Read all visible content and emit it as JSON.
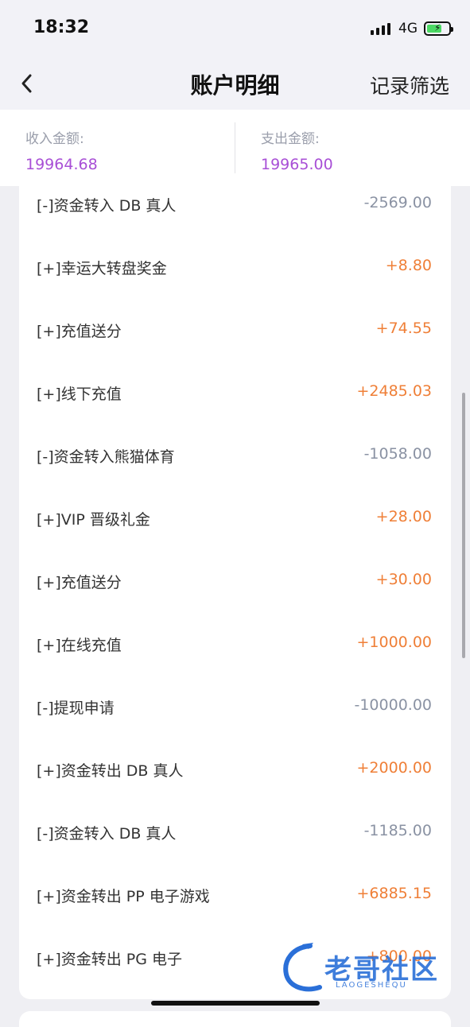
{
  "status_bar": {
    "time": "18:32",
    "network": "4G"
  },
  "nav": {
    "title": "账户明细",
    "filter_label": "记录筛选"
  },
  "summary": {
    "income_label": "收入金额:",
    "income_value": "19964.68",
    "expense_label": "支出金额:",
    "expense_value": "19965.00"
  },
  "records": [
    {
      "label": "[-]资金转入 DB 真人",
      "amount": "-2569.00",
      "type": "neg"
    },
    {
      "label": "[+]幸运大转盘奖金",
      "amount": "+8.80",
      "type": "pos"
    },
    {
      "label": "[+]充值送分",
      "amount": "+74.55",
      "type": "pos"
    },
    {
      "label": "[+]线下充值",
      "amount": "+2485.03",
      "type": "pos"
    },
    {
      "label": "[-]资金转入熊猫体育",
      "amount": "-1058.00",
      "type": "neg"
    },
    {
      "label": "[+]VIP 晋级礼金",
      "amount": "+28.00",
      "type": "pos"
    },
    {
      "label": "[+]充值送分",
      "amount": "+30.00",
      "type": "pos"
    },
    {
      "label": "[+]在线充值",
      "amount": "+1000.00",
      "type": "pos"
    },
    {
      "label": "[-]提现申请",
      "amount": "-10000.00",
      "type": "neg"
    },
    {
      "label": "[+]资金转出 DB 真人",
      "amount": "+2000.00",
      "type": "pos"
    },
    {
      "label": "[-]资金转入 DB 真人",
      "amount": "-1185.00",
      "type": "neg"
    },
    {
      "label": "[+]资金转出 PP 电子游戏",
      "amount": "+6885.15",
      "type": "pos"
    },
    {
      "label": "[+]资金转出 PG 电子",
      "amount": "+800.00",
      "type": "pos"
    }
  ],
  "watermark": {
    "text": "老哥社区",
    "sub": "LAOGESHEQU"
  },
  "colors": {
    "positive": "#ef7f37",
    "negative": "#8a92a3",
    "summary_value": "#a84fd6"
  }
}
